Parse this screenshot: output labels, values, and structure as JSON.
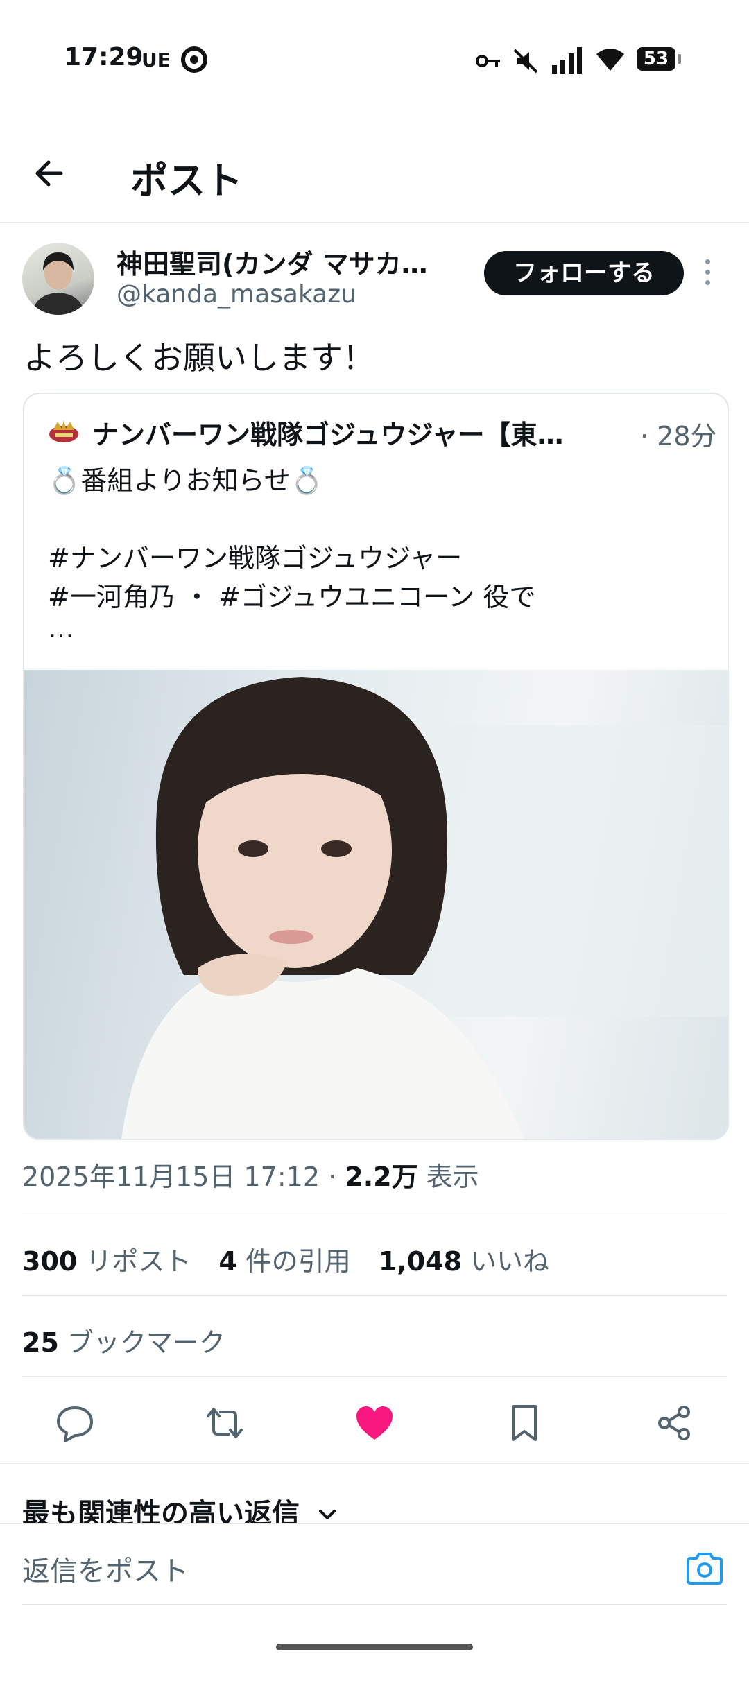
{
  "status_bar": {
    "time": "17:29",
    "carrier": "UE",
    "battery": "53"
  },
  "header": {
    "title": "ポスト"
  },
  "author": {
    "name": "神田聖司(カンダ マサカ…",
    "handle": "@kanda_masakazu",
    "follow_label": "フォローする"
  },
  "post": {
    "text": "よろしくお願いします！"
  },
  "quote": {
    "name": "ナンバーワン戦隊ゴジュウジャー【東…",
    "time": "· 28分",
    "lines": [
      "💍番組よりお知らせ💍",
      "#ナンバーワン戦隊ゴジュウジャー",
      "#一河角乃 ・ #ゴジュウユニコーン 役で",
      "…"
    ]
  },
  "meta": {
    "datetime": "2025年11月15日 17:12 · ",
    "views_num": "2.2万",
    "views_label": " 表示"
  },
  "stats": {
    "reposts_num": "300",
    "reposts_label": "リポスト",
    "quotes_num": "4",
    "quotes_label": "件の引用",
    "likes_num": "1,048",
    "likes_label": "いいね",
    "bookmarks_num": "25",
    "bookmarks_label": "ブックマーク"
  },
  "replies": {
    "sort_label": "最も関連性の高い返信",
    "placeholder": "返信をポスト"
  },
  "colors": {
    "like": "#f91880",
    "follow_bg": "#0f1419",
    "secondary_text": "#536471",
    "camera": "#1d9bf0"
  }
}
